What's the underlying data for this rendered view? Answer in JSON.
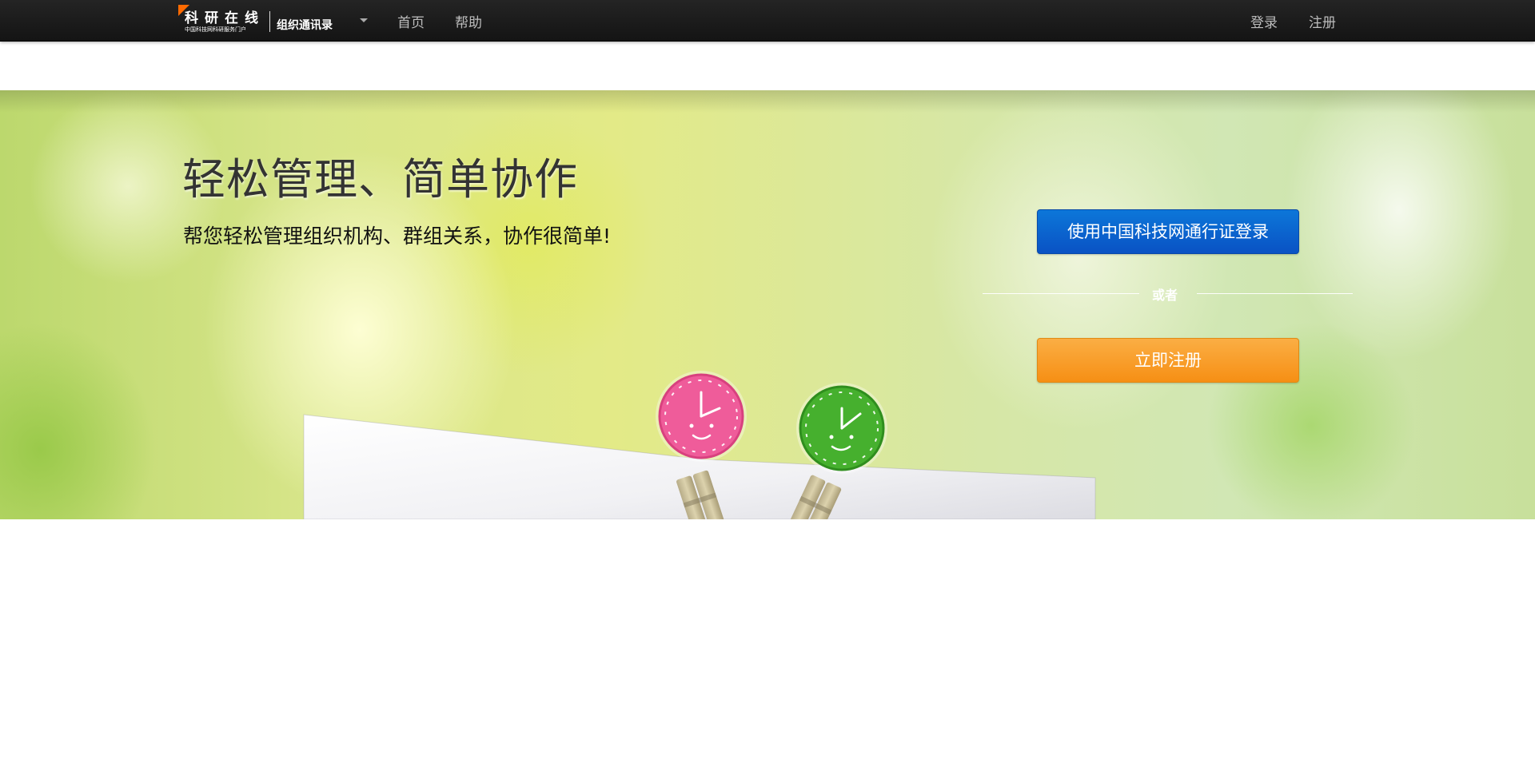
{
  "navbar": {
    "brand": {
      "title": "科研在线",
      "subtitle": "中国科技网科研服务门户",
      "product": "组织通讯录"
    },
    "links": {
      "home": "首页",
      "help": "帮助",
      "login": "登录",
      "register": "注册"
    }
  },
  "hero": {
    "title": "轻松管理、简单协作",
    "subtitle": "帮您轻松管理组织机构、群组关系，协作很简单!",
    "passport_login_button": "使用中国科技网通行证登录",
    "or_label": "或者",
    "register_button": "立即注册"
  },
  "colors": {
    "navbar_bg": "#1b1b1b",
    "brand_accent": "#ff6a00",
    "passport_button": "#0a5fcf",
    "register_button": "#f8a02c",
    "clip_pink": "#ef5c9a",
    "clip_green": "#46b02e"
  },
  "icons": {
    "brand_caret": "caret-down-icon"
  }
}
